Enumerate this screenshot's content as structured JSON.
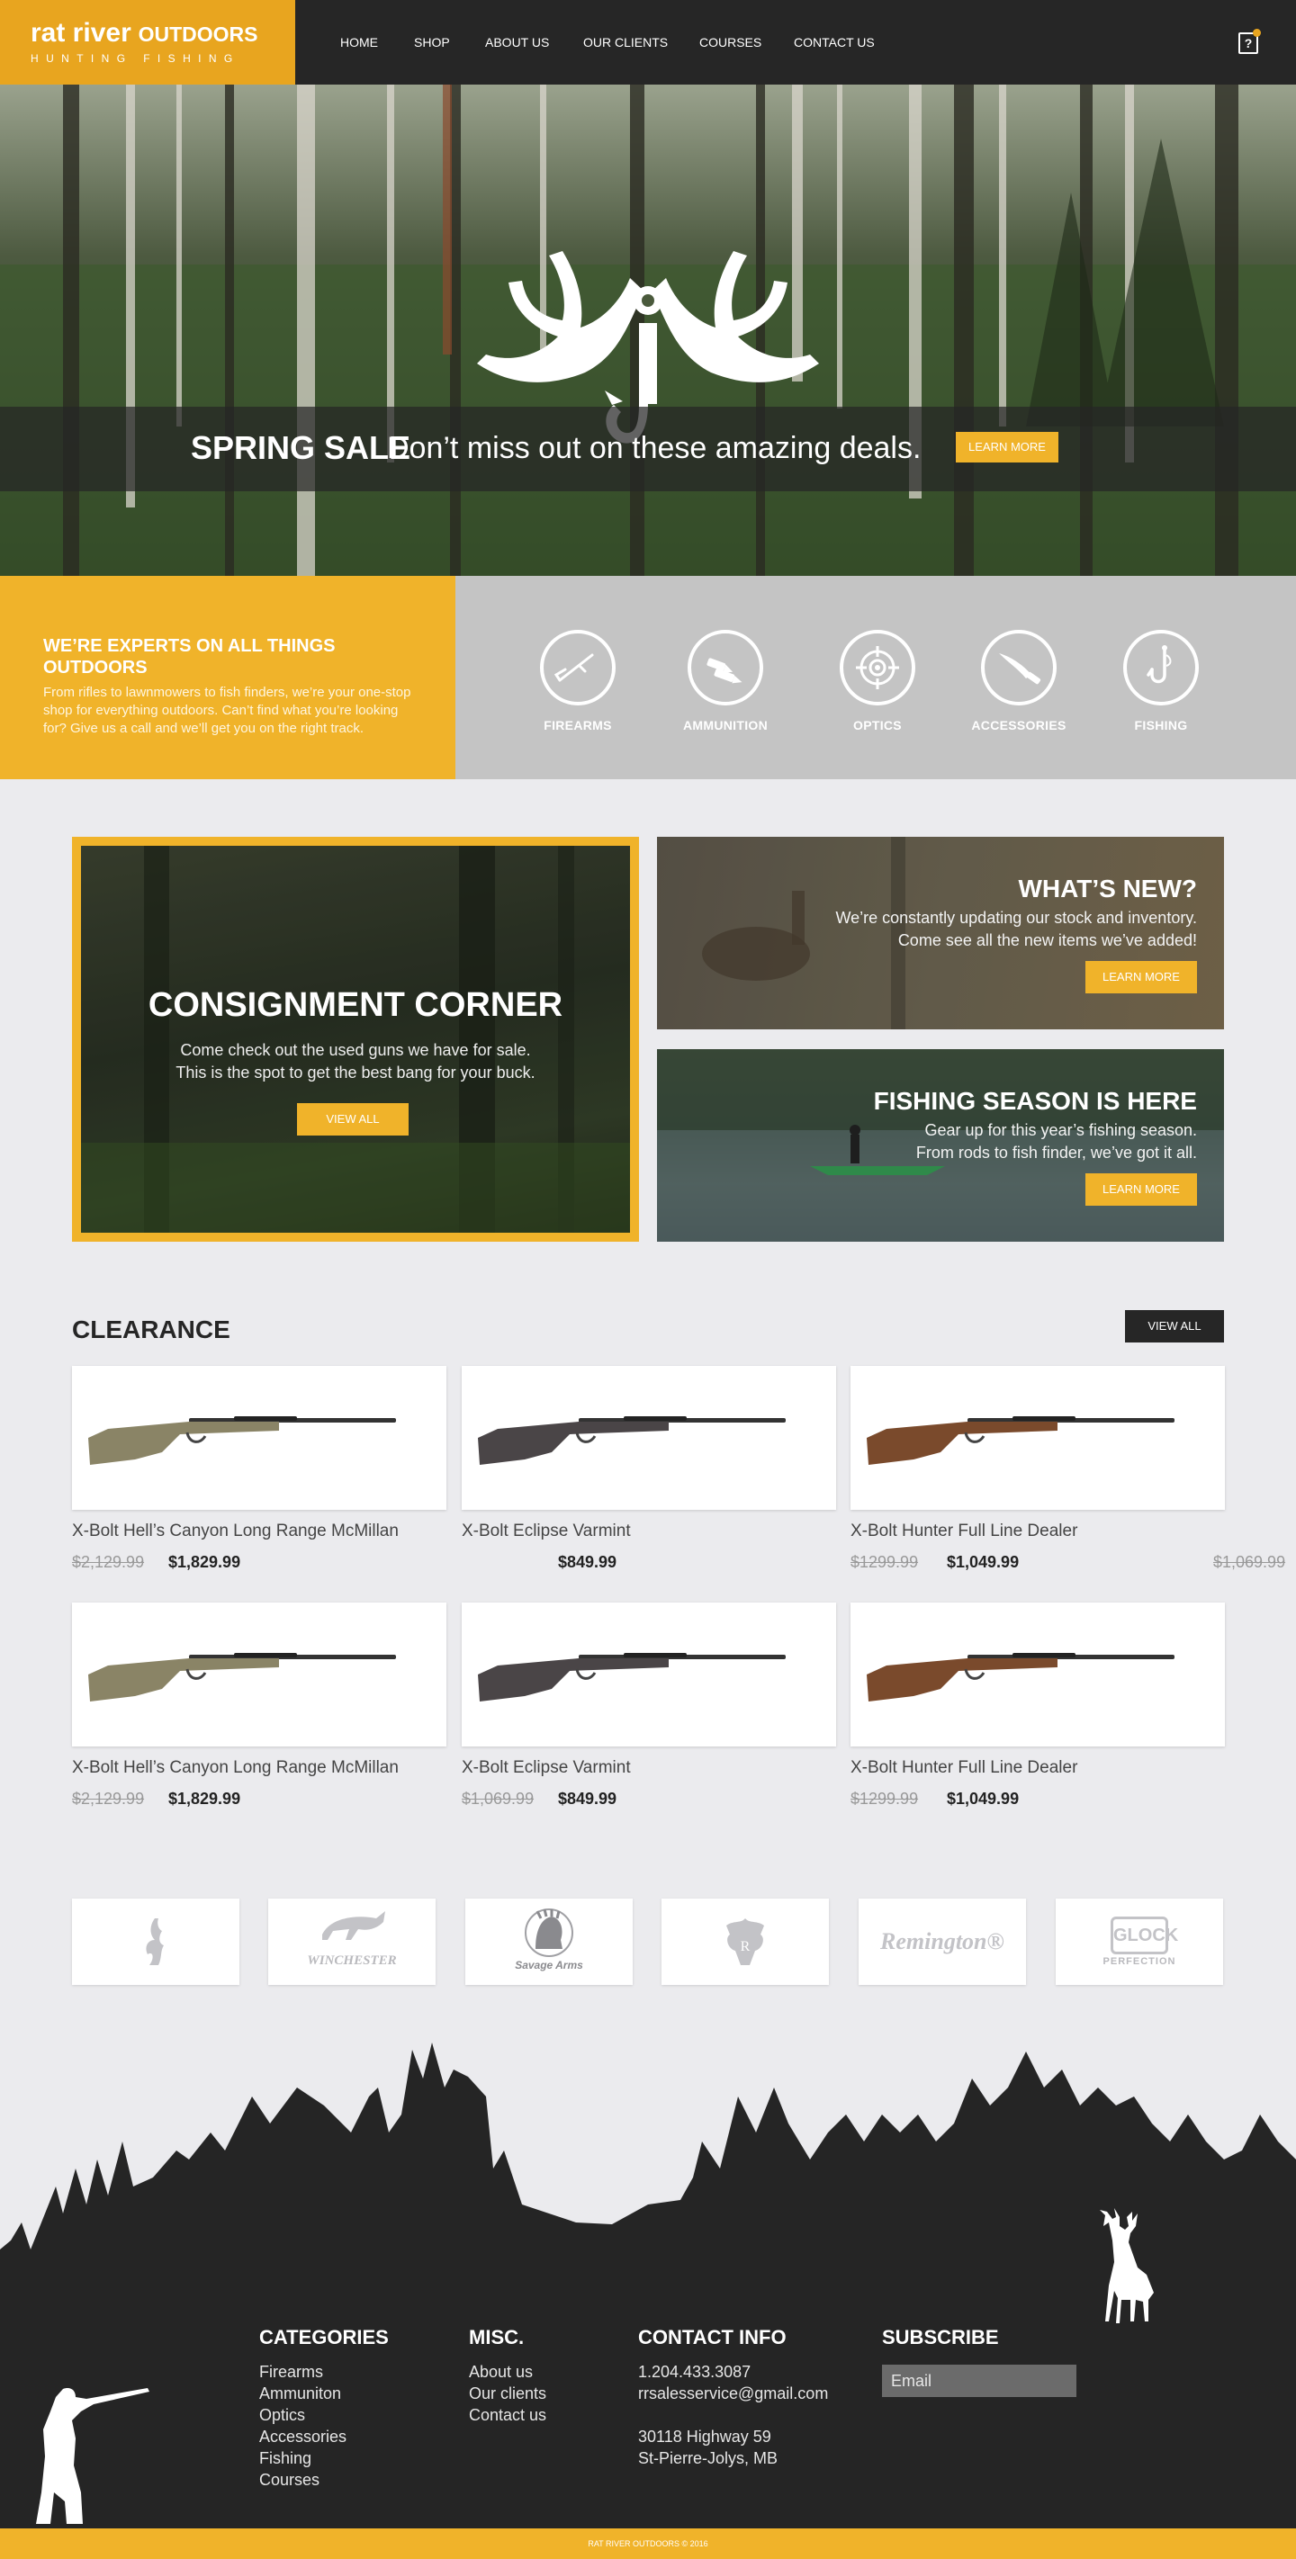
{
  "brand": {
    "name_main": "rat river",
    "name_outdoors": "OUTDOORS",
    "tagline": "HUNTING FISHING"
  },
  "nav": {
    "items": [
      "HOME",
      "SHOP",
      "ABOUT US",
      "OUR CLIENTS",
      "COURSES",
      "CONTACT US"
    ],
    "cart_icon": "?"
  },
  "hero": {
    "sale_title": "SPRING SALE",
    "sale_sub": "Don’t miss out on these amazing deals.",
    "button": "LEARN MORE"
  },
  "experts": {
    "title": "WE’RE EXPERTS ON ALL THINGS OUTDOORS",
    "text": "From rifles to lawnmowers to fish finders, we’re your one-stop shop for everything outdoors. Can’t find what you’re looking for? Give us a call and we’ll get you on the right track."
  },
  "categories": [
    {
      "label": "FIREARMS",
      "icon": "rifle-icon"
    },
    {
      "label": "AMMUNITION",
      "icon": "bullets-icon"
    },
    {
      "label": "OPTICS",
      "icon": "crosshair-icon"
    },
    {
      "label": "ACCESSORIES",
      "icon": "knife-icon"
    },
    {
      "label": "FISHING",
      "icon": "fishhook-icon"
    }
  ],
  "consignment": {
    "title": "CONSIGNMENT CORNER",
    "line1": "Come check out the used guns we have for sale.",
    "line2": "This is the spot to get the best bang for your buck.",
    "button": "VIEW ALL"
  },
  "whats_new": {
    "title": "WHAT’S NEW?",
    "line1": "We’re constantly updating our stock and inventory.",
    "line2": "Come see all  the new items we’ve added!",
    "button": "LEARN MORE"
  },
  "fishing_season": {
    "title": "FISHING SEASON IS HERE",
    "line1": "Gear up for this year’s fishing season.",
    "line2": "From rods to fish finder, we’ve got it all.",
    "button": "LEARN MORE"
  },
  "clearance": {
    "title": "CLEARANCE",
    "view_all": "VIEW ALL",
    "rows": [
      [
        {
          "name": "X-Bolt Hell’s Canyon Long Range McMillan",
          "old": "$2,129.99",
          "new": "$1,829.99",
          "stock": "#8a8466"
        },
        {
          "name": "X-Bolt Eclipse Varmint",
          "old": "",
          "new": "$849.99",
          "stock": "#4a4547"
        },
        {
          "name": "X-Bolt Hunter Full Line Dealer",
          "old": "$1299.99",
          "new": "$1,049.99",
          "stock": "#7a4a2c"
        }
      ],
      [
        {
          "name": "X-Bolt Hell’s Canyon Long Range McMillan",
          "old": "$2,129.99",
          "new": "$1,829.99",
          "stock": "#8a8466"
        },
        {
          "name": "X-Bolt Eclipse Varmint",
          "old": "$1,069.99",
          "new": "$849.99",
          "stock": "#4a4547"
        },
        {
          "name": "X-Bolt Hunter Full Line Dealer",
          "old": "$1299.99",
          "new": "$1,049.99",
          "stock": "#7a4a2c"
        }
      ]
    ],
    "stray_old_price": "$1,069.99"
  },
  "brands": [
    {
      "name": "",
      "icon": "buckmark-logo"
    },
    {
      "name": "WINCHESTER",
      "icon": "horse-rider-logo"
    },
    {
      "name": "Savage Arms",
      "icon": "indian-head-logo"
    },
    {
      "name": "R",
      "icon": "ruger-eagle-logo"
    },
    {
      "name": "Remington®",
      "icon": "remington-logo"
    },
    {
      "name": "PERFECTION",
      "icon": "glock-logo",
      "mark": "GLOCK"
    }
  ],
  "footer": {
    "categories": {
      "title": "CATEGORIES",
      "items": [
        "Firearms",
        "Ammuniton",
        "Optics",
        "Accessories",
        "Fishing",
        "Courses"
      ]
    },
    "misc": {
      "title": "MISC.",
      "items": [
        "About us",
        "Our clients",
        "Contact us"
      ]
    },
    "contact": {
      "title": "CONTACT INFO",
      "phone": "1.204.433.3087",
      "email": "rrsalesservice@gmail.com",
      "address1": "30118 Highway 59",
      "address2": "St-Pierre-Jolys, MB"
    },
    "subscribe": {
      "title": "SUBSCRIBE",
      "placeholder": "Email"
    },
    "copyright": "RAT RIVER OUTDOORS © 2016"
  },
  "colors": {
    "accent": "#f0b32a",
    "dark": "#262626",
    "page": "#ebebee",
    "category_band": "#c4c4c4"
  }
}
